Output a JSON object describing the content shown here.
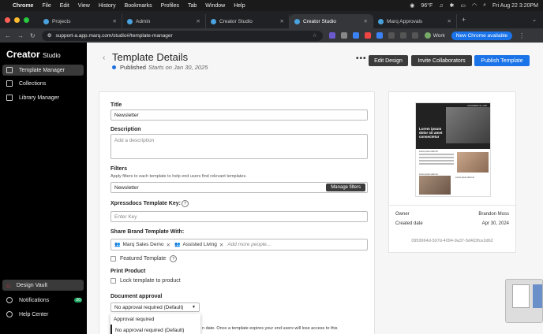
{
  "menubar": {
    "app": "Chrome",
    "items": [
      "File",
      "Edit",
      "View",
      "History",
      "Bookmarks",
      "Profiles",
      "Tab",
      "Window",
      "Help"
    ],
    "weather": "96°F",
    "datetime": "Fri Aug 22  3:20PM"
  },
  "tabs": [
    {
      "title": "Projects",
      "active": false
    },
    {
      "title": "Admin",
      "active": false
    },
    {
      "title": "Creator Studio",
      "active": false
    },
    {
      "title": "Creator Studio",
      "active": true
    },
    {
      "title": "Marq Approvals",
      "active": false
    }
  ],
  "address": {
    "url": "support-a.app.marq.com/studio#/template-manager",
    "profile": "Work",
    "new_chrome": "New Chrome available"
  },
  "sidebar": {
    "logo_main": "Creator",
    "logo_sub": "Studio",
    "items": [
      {
        "label": "Template Manager",
        "active": true
      },
      {
        "label": "Collections",
        "active": false
      },
      {
        "label": "Library Manager",
        "active": false
      }
    ],
    "bottom": [
      {
        "label": "Design Vault",
        "active": true
      },
      {
        "label": "Notifications",
        "badge": "20"
      },
      {
        "label": "Help Center"
      }
    ]
  },
  "header": {
    "title": "Template Details",
    "status": "Published",
    "starts": "Starts on Jan 30, 2025",
    "more": "•••",
    "buttons": {
      "edit": "Edit Design",
      "invite": "Invite Collaborators",
      "publish": "Publish Template"
    }
  },
  "form": {
    "title_label": "Title",
    "title_value": "Newsletter",
    "desc_label": "Description",
    "desc_placeholder": "Add a description",
    "filters_label": "Filters",
    "filters_hint": "Apply filters to each template to help end users find relevant templates.",
    "filters_value": "Newsletter",
    "manage_filters": "Manage filters",
    "xpress_label": "Xpressdocs Template Key:",
    "xpress_placeholder": "Enter Key",
    "share_label": "Share Brand Template With:",
    "chips": [
      "Marq Sales Demo",
      "Assisted Living"
    ],
    "add_more": "Add more people...",
    "featured_label": "Featured Template",
    "print_label": "Print Product",
    "lock_label": "Lock template to product",
    "approval_label": "Document approval",
    "approval_value": "No approval required (Default)",
    "approval_options": [
      "Approval required",
      "No approval required (Default)"
    ],
    "expire_text": "n date. Once a template expires your end users will lose access to this"
  },
  "preview": {
    "owner_label": "Owner",
    "owner_value": "Brandon Moss",
    "created_label": "Created date",
    "created_value": "Apr 30, 2024",
    "guid": "0959964d-597d-4094-9a37-5d403fce2d62",
    "thumb": {
      "date": "DECEMBER 30, 2025",
      "headline": "Lorem ipsum dolor sit amet consectetur",
      "sub1": "Lorem ipsum dolor sit",
      "sub2": "Lorem ipsum dolor sit",
      "sub3": "Lorem ipsum dolor sit"
    }
  },
  "colors": {
    "accent": "#1a73e8",
    "dark_button": "#3b3b3b",
    "sidebar_bg": "#000000"
  }
}
